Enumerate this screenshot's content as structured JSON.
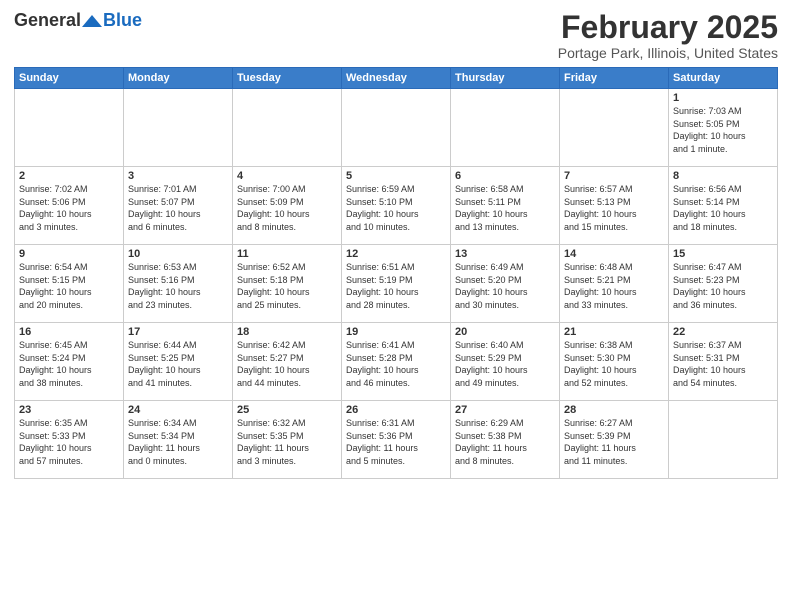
{
  "header": {
    "logo_general": "General",
    "logo_blue": "Blue",
    "title": "February 2025",
    "location": "Portage Park, Illinois, United States"
  },
  "weekdays": [
    "Sunday",
    "Monday",
    "Tuesday",
    "Wednesday",
    "Thursday",
    "Friday",
    "Saturday"
  ],
  "weeks": [
    [
      {
        "day": "",
        "info": ""
      },
      {
        "day": "",
        "info": ""
      },
      {
        "day": "",
        "info": ""
      },
      {
        "day": "",
        "info": ""
      },
      {
        "day": "",
        "info": ""
      },
      {
        "day": "",
        "info": ""
      },
      {
        "day": "1",
        "info": "Sunrise: 7:03 AM\nSunset: 5:05 PM\nDaylight: 10 hours\nand 1 minute."
      }
    ],
    [
      {
        "day": "2",
        "info": "Sunrise: 7:02 AM\nSunset: 5:06 PM\nDaylight: 10 hours\nand 3 minutes."
      },
      {
        "day": "3",
        "info": "Sunrise: 7:01 AM\nSunset: 5:07 PM\nDaylight: 10 hours\nand 6 minutes."
      },
      {
        "day": "4",
        "info": "Sunrise: 7:00 AM\nSunset: 5:09 PM\nDaylight: 10 hours\nand 8 minutes."
      },
      {
        "day": "5",
        "info": "Sunrise: 6:59 AM\nSunset: 5:10 PM\nDaylight: 10 hours\nand 10 minutes."
      },
      {
        "day": "6",
        "info": "Sunrise: 6:58 AM\nSunset: 5:11 PM\nDaylight: 10 hours\nand 13 minutes."
      },
      {
        "day": "7",
        "info": "Sunrise: 6:57 AM\nSunset: 5:13 PM\nDaylight: 10 hours\nand 15 minutes."
      },
      {
        "day": "8",
        "info": "Sunrise: 6:56 AM\nSunset: 5:14 PM\nDaylight: 10 hours\nand 18 minutes."
      }
    ],
    [
      {
        "day": "9",
        "info": "Sunrise: 6:54 AM\nSunset: 5:15 PM\nDaylight: 10 hours\nand 20 minutes."
      },
      {
        "day": "10",
        "info": "Sunrise: 6:53 AM\nSunset: 5:16 PM\nDaylight: 10 hours\nand 23 minutes."
      },
      {
        "day": "11",
        "info": "Sunrise: 6:52 AM\nSunset: 5:18 PM\nDaylight: 10 hours\nand 25 minutes."
      },
      {
        "day": "12",
        "info": "Sunrise: 6:51 AM\nSunset: 5:19 PM\nDaylight: 10 hours\nand 28 minutes."
      },
      {
        "day": "13",
        "info": "Sunrise: 6:49 AM\nSunset: 5:20 PM\nDaylight: 10 hours\nand 30 minutes."
      },
      {
        "day": "14",
        "info": "Sunrise: 6:48 AM\nSunset: 5:21 PM\nDaylight: 10 hours\nand 33 minutes."
      },
      {
        "day": "15",
        "info": "Sunrise: 6:47 AM\nSunset: 5:23 PM\nDaylight: 10 hours\nand 36 minutes."
      }
    ],
    [
      {
        "day": "16",
        "info": "Sunrise: 6:45 AM\nSunset: 5:24 PM\nDaylight: 10 hours\nand 38 minutes."
      },
      {
        "day": "17",
        "info": "Sunrise: 6:44 AM\nSunset: 5:25 PM\nDaylight: 10 hours\nand 41 minutes."
      },
      {
        "day": "18",
        "info": "Sunrise: 6:42 AM\nSunset: 5:27 PM\nDaylight: 10 hours\nand 44 minutes."
      },
      {
        "day": "19",
        "info": "Sunrise: 6:41 AM\nSunset: 5:28 PM\nDaylight: 10 hours\nand 46 minutes."
      },
      {
        "day": "20",
        "info": "Sunrise: 6:40 AM\nSunset: 5:29 PM\nDaylight: 10 hours\nand 49 minutes."
      },
      {
        "day": "21",
        "info": "Sunrise: 6:38 AM\nSunset: 5:30 PM\nDaylight: 10 hours\nand 52 minutes."
      },
      {
        "day": "22",
        "info": "Sunrise: 6:37 AM\nSunset: 5:31 PM\nDaylight: 10 hours\nand 54 minutes."
      }
    ],
    [
      {
        "day": "23",
        "info": "Sunrise: 6:35 AM\nSunset: 5:33 PM\nDaylight: 10 hours\nand 57 minutes."
      },
      {
        "day": "24",
        "info": "Sunrise: 6:34 AM\nSunset: 5:34 PM\nDaylight: 11 hours\nand 0 minutes."
      },
      {
        "day": "25",
        "info": "Sunrise: 6:32 AM\nSunset: 5:35 PM\nDaylight: 11 hours\nand 3 minutes."
      },
      {
        "day": "26",
        "info": "Sunrise: 6:31 AM\nSunset: 5:36 PM\nDaylight: 11 hours\nand 5 minutes."
      },
      {
        "day": "27",
        "info": "Sunrise: 6:29 AM\nSunset: 5:38 PM\nDaylight: 11 hours\nand 8 minutes."
      },
      {
        "day": "28",
        "info": "Sunrise: 6:27 AM\nSunset: 5:39 PM\nDaylight: 11 hours\nand 11 minutes."
      },
      {
        "day": "",
        "info": ""
      }
    ]
  ]
}
